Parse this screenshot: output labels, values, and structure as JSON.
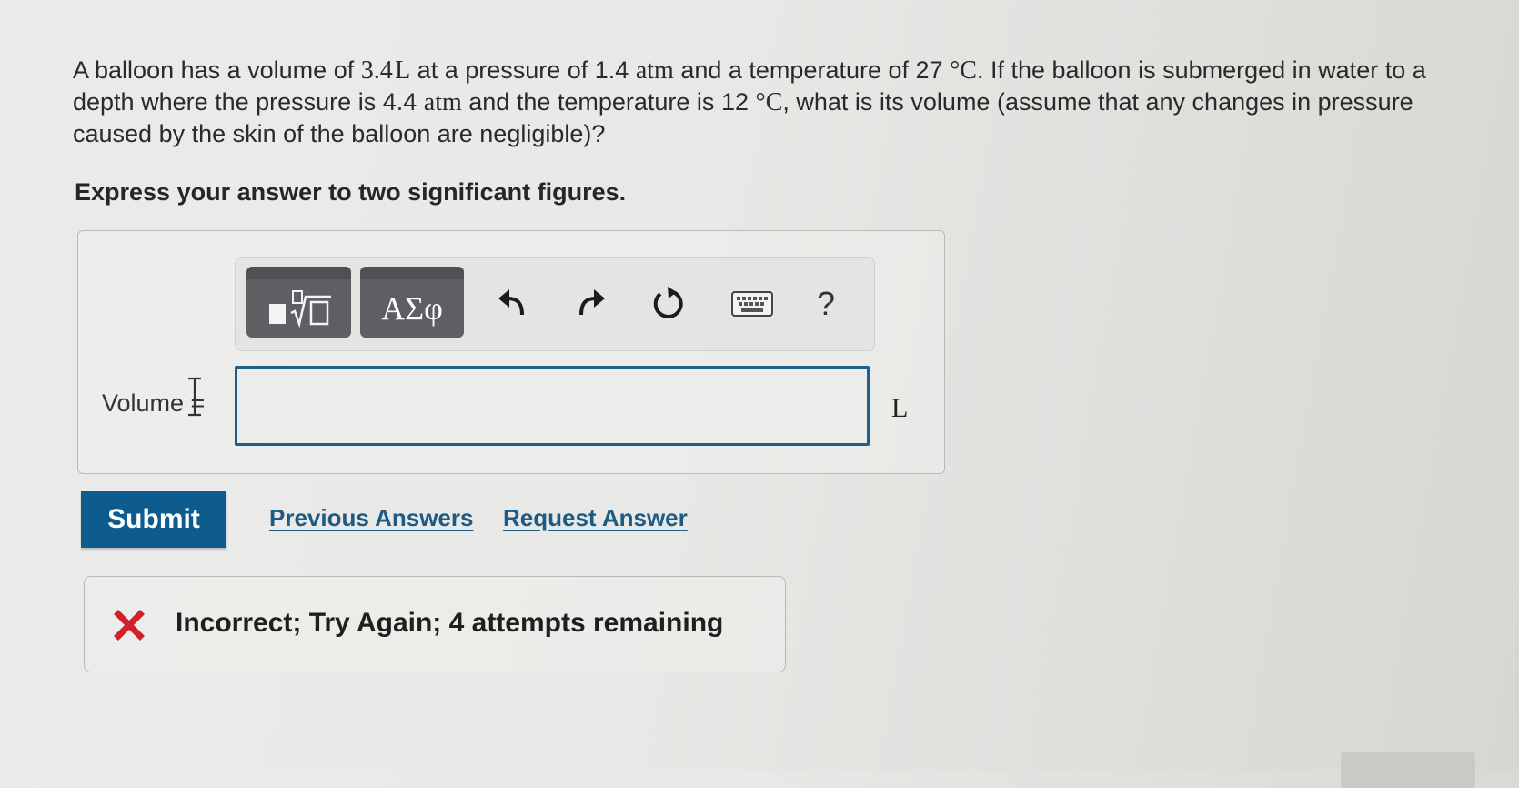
{
  "question": {
    "part1": "A balloon has a volume of ",
    "v1": "3.4",
    "v1_unit": "L",
    "part2": " at a pressure of ",
    "p1": "1.4",
    "p1_unit": "atm",
    "part3": " and a temperature of ",
    "t1": "27",
    "t1_unit": "°C",
    "part4": ". If the balloon is submerged in water to a depth where the pressure is ",
    "p2": "4.4",
    "p2_unit": "atm",
    "part5": " and the temperature is ",
    "t2": "12",
    "t2_unit": "°C",
    "part6": ", what is its volume (assume that any changes in pressure caused by the skin of the balloon are negligible)?"
  },
  "instruction": "Express your answer to two significant figures.",
  "toolbar": {
    "templates_icon": "templates-icon",
    "greek_label": "ΑΣφ",
    "undo_icon": "undo-icon",
    "redo_icon": "redo-icon",
    "reset_icon": "reset-icon",
    "keyboard_icon": "keyboard-icon",
    "help_label": "?"
  },
  "answer": {
    "label": "Volume =",
    "value": "",
    "unit": "L"
  },
  "actions": {
    "submit_label": "Submit",
    "previous_answers_label": "Previous Answers",
    "request_answer_label": "Request Answer"
  },
  "feedback": {
    "message": "Incorrect; Try Again; 4 attempts remaining",
    "icon": "x-mark-icon",
    "icon_color": "#d0202a"
  },
  "colors": {
    "primary": "#0e5b8e",
    "link": "#1d5a84",
    "input_border": "#1f5f8a",
    "error": "#d0202a"
  }
}
